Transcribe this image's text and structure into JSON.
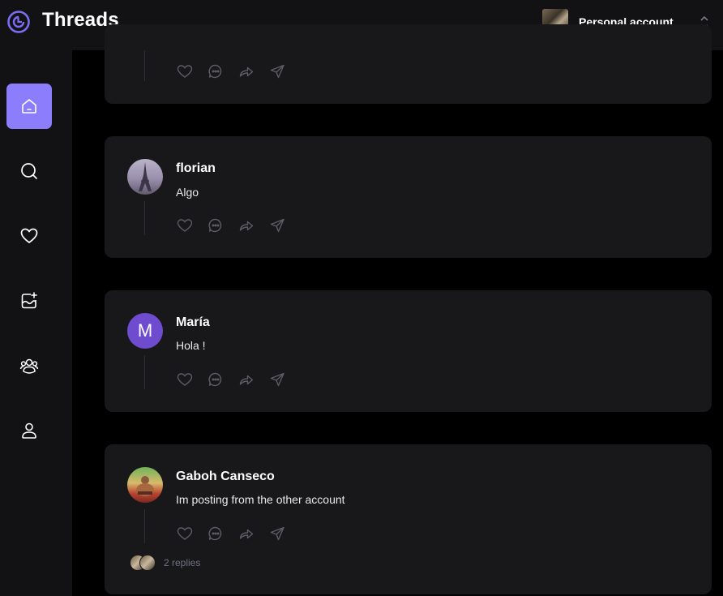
{
  "app": {
    "title": "Threads",
    "logo_icon": "threads-logo-icon"
  },
  "account": {
    "name": "Personal account",
    "chevron_icon": "chevron-up-down-icon"
  },
  "sidebar": {
    "accent": "#8b7dfb",
    "items": [
      {
        "icon": "home-icon",
        "active": true
      },
      {
        "icon": "search-icon",
        "active": false
      },
      {
        "icon": "heart-icon",
        "active": false
      },
      {
        "icon": "create-post-icon",
        "active": false
      },
      {
        "icon": "community-icon",
        "active": false
      },
      {
        "icon": "profile-icon",
        "active": false
      }
    ]
  },
  "posts": [
    {
      "username": "",
      "text": "",
      "avatar": "",
      "replies": ""
    },
    {
      "username": "florian",
      "text": "Algo",
      "avatar": "eiffel-tower-photo"
    },
    {
      "username": "María",
      "text": "Hola !",
      "avatar_initial": "M",
      "avatar_color": "#6f4bd0"
    },
    {
      "username": "Gaboh Canseco",
      "text": "Im posting from the other account",
      "avatar": "sumo-figure-photo",
      "replies": "2 replies"
    }
  ],
  "actions": [
    "like-icon",
    "comment-icon",
    "repost-icon",
    "share-icon"
  ]
}
